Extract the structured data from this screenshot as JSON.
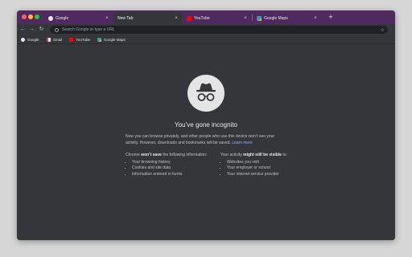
{
  "tabs": [
    {
      "label": "Google",
      "favicon": "google-icon",
      "active": false
    },
    {
      "label": "New Tab",
      "favicon": "incognito-icon",
      "active": true
    },
    {
      "label": "YouTube",
      "favicon": "youtube-icon",
      "active": false
    },
    {
      "label": "Google Maps",
      "favicon": "maps-icon",
      "active": false
    }
  ],
  "tab_close": "×",
  "new_tab": "+",
  "toolbar": {
    "back": "←",
    "forward": "→",
    "reload": "↻",
    "star": "☆",
    "incognito_badge": "◓",
    "menu": "⋮"
  },
  "omnibox": {
    "placeholder": "Search Google or type a URL"
  },
  "bookmarks": [
    {
      "label": "Google",
      "icon": "google-icon"
    },
    {
      "label": "Gmail",
      "icon": "gmail-icon"
    },
    {
      "label": "YouTube",
      "icon": "youtube-icon"
    },
    {
      "label": "Google Maps",
      "icon": "maps-icon"
    }
  ],
  "incognito": {
    "title": "You’ve gone incognito",
    "intro": "Now you can browse privately, and other people who use this device won’t see your activity. However, downloads and bookmarks will be saved.",
    "learn_more": "Learn more",
    "left_heading_pre": "Chrome ",
    "left_heading_bold": "won’t save",
    "left_heading_post": " the following information:",
    "left_items": [
      "Your browsing history",
      "Cookies and site data",
      "Information entered in forms"
    ],
    "right_heading_pre": "Your activity ",
    "right_heading_bold": "might still be visible",
    "right_heading_post": " to:",
    "right_items": [
      "Websites you visit",
      "Your employer or school",
      "Your internet service provider"
    ]
  },
  "colors": {
    "tabstrip": "#4f2a5f",
    "background": "#35363a",
    "omnibox": "#202124",
    "link": "#8ab4f8"
  }
}
